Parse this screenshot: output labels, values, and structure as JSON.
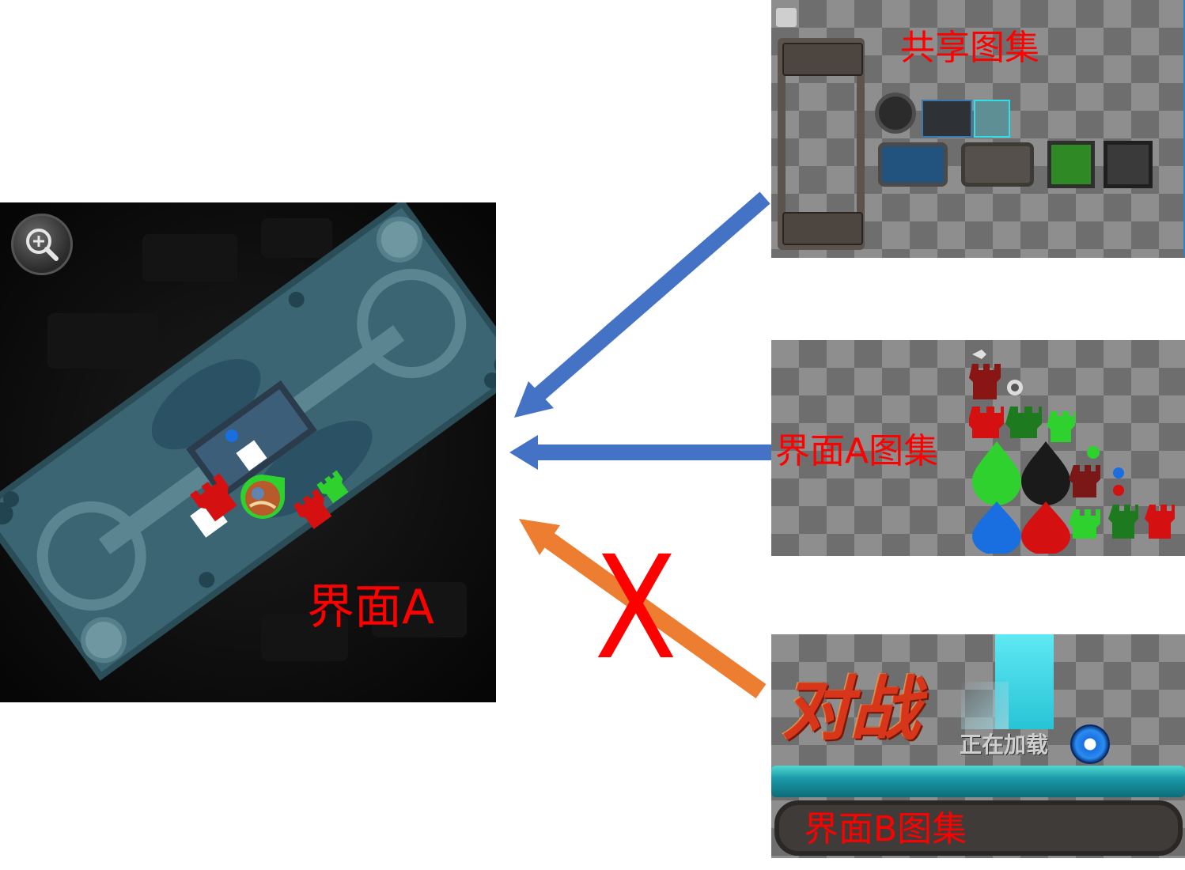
{
  "panel_a": {
    "label": "界面A"
  },
  "shared_atlas": {
    "label": "共享图集"
  },
  "atlas_a": {
    "label": "界面A图集"
  },
  "atlas_b": {
    "label": "界面B图集",
    "battle_text": "对战",
    "loading_text": "正在加载"
  },
  "cross_mark": "X",
  "colors": {
    "arrow_blue": "#4472c4",
    "arrow_orange": "#ed7d31",
    "label_red": "#ff0000",
    "map_teal": "#3b6573",
    "team_red": "#d41010",
    "team_green": "#2fd12f",
    "team_blue": "#1a6fe0",
    "loading_cyan": "#27c4d6"
  },
  "icons": [
    "magnifier-icon",
    "hero-avatar-icon",
    "tower-icon",
    "drop-marker-icon",
    "loading-spinner-icon"
  ]
}
